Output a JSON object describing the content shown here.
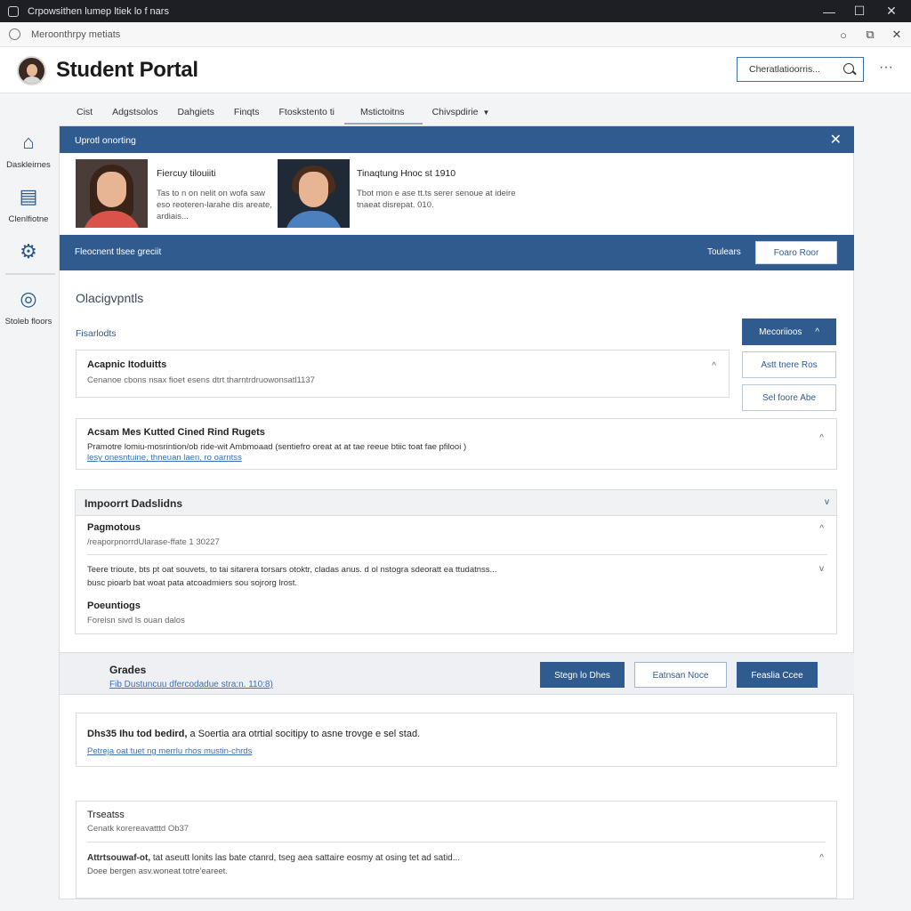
{
  "window": {
    "title": "Crpowsithen lumep ltiek lo f nars",
    "controls": {
      "minimize": "—",
      "maximize": "☐",
      "close": "✕"
    }
  },
  "address_bar": {
    "url": "Meroonthrpy metiats",
    "icons": [
      "circle-icon",
      "share-icon",
      "close-icon"
    ]
  },
  "header": {
    "brand": "Student Portal",
    "search_text": "Cheratlatioorris...",
    "more": "···"
  },
  "topnav": {
    "tabs": [
      {
        "label": "Cist"
      },
      {
        "label": "Adgstsolos"
      },
      {
        "label": "Dahgiets"
      },
      {
        "label": "Finqts"
      },
      {
        "label": "Ftoskstento ti"
      },
      {
        "label": "Mstictoitns",
        "active": true
      },
      {
        "label": "Chivspdirie",
        "dropdown": true
      }
    ]
  },
  "sidebar": {
    "items": [
      {
        "label": "Daskleirnes",
        "icon": "home-icon"
      },
      {
        "label": "Clenlfiotne",
        "icon": "document-icon"
      },
      {
        "label": "",
        "icon": "gear-icon"
      },
      {
        "label": "Stoleb floors",
        "icon": "clock-icon"
      }
    ]
  },
  "modal": {
    "title": "Uprotl onorting",
    "close": "✕",
    "profiles": [
      {
        "name": "Fiercuy tilouiiti",
        "desc": "Tas to n on nelit on wofa saw eso reoteren-larahe dis areate, ardiais..."
      },
      {
        "name": "Tinaqtung Hnoc st 1910",
        "desc": "Tbot mon e ase tt.ts serer senoue at ideire tnaeat disrepat. 010."
      }
    ]
  },
  "banner": {
    "text": "Fleocnent tlsee greciit",
    "sub": "Toulears",
    "button": "Foaro Roor"
  },
  "overview": {
    "title": "Olacigvpntls",
    "label": "Fisarlodts"
  },
  "cards": [
    {
      "title": "Acapnic Itoduitts",
      "desc": "Cenanoe cbons nsax fioet esens dtrt tharntrdruowonsatl1137",
      "chevron": "^"
    },
    {
      "title": "Acsam Mes Kutted Cined Rind Rugets",
      "desc": "Pramotre lomiu-mosrintion/ob ride-wit Ambmoaad (sentiefro oreat at at tae reeue btiic toat fae pfilooi )",
      "link": "lesy onesntuine, thneuan laen, ro oarntss",
      "chevron": "^"
    }
  ],
  "side_buttons": [
    {
      "label": "Mecoriioos",
      "chevron": "^"
    },
    {
      "label": "Astt tnere Ros"
    },
    {
      "label": "Sel foore Abe"
    }
  ],
  "accordion": {
    "title": "Impoorrt Dadslidns",
    "chevron": "v",
    "items": [
      {
        "title": "Pagmotous",
        "meta": "/reaporpnorrdUlarase-ffate 1 30227",
        "chevron": "^"
      },
      {
        "text_line1": "Teere trioute, bts pt oat souvets, to tai sitarera torsars otoktr, cladas anus. d ol nstogra sdeoratt ea ttudatnss...",
        "text_line2": "busc pioarb bat woat pata atcoadmiers sou sojrorg lrost.",
        "chevron": "v"
      },
      {
        "title": "Poeuntiogs",
        "meta": "Foreisn sivd ls ouan dalos"
      }
    ]
  },
  "grades": {
    "title": "Grades",
    "subtitle": "Fib Dustuncuu dfercodadue  stra:n.  110:8)",
    "buttons": [
      "Stegn lo Dhes",
      "Eatnsan Noce",
      "Feaslia Ccee"
    ]
  },
  "bottom_cards": [
    {
      "title": "Dhs35 Ihu tod bedird,",
      "desc": " a Soertia ara otrtial socitipy to asne trovge e sel stad.",
      "link": "Petreja oat tuet ng merrlu rhos mustin-chrds"
    },
    {
      "title": "Trseatss",
      "meta": "Cenatk korereavatttd Ob37",
      "item_title": "Attrtsouwaf-ot,",
      "item_desc": " tat aseutt lonits las bate ctanrd, tseg aea sattaire eosmy at osing tet ad satid...",
      "item_line2": "Doee bergen asv.woneat totre'eareet.",
      "chevron": "^"
    }
  ]
}
